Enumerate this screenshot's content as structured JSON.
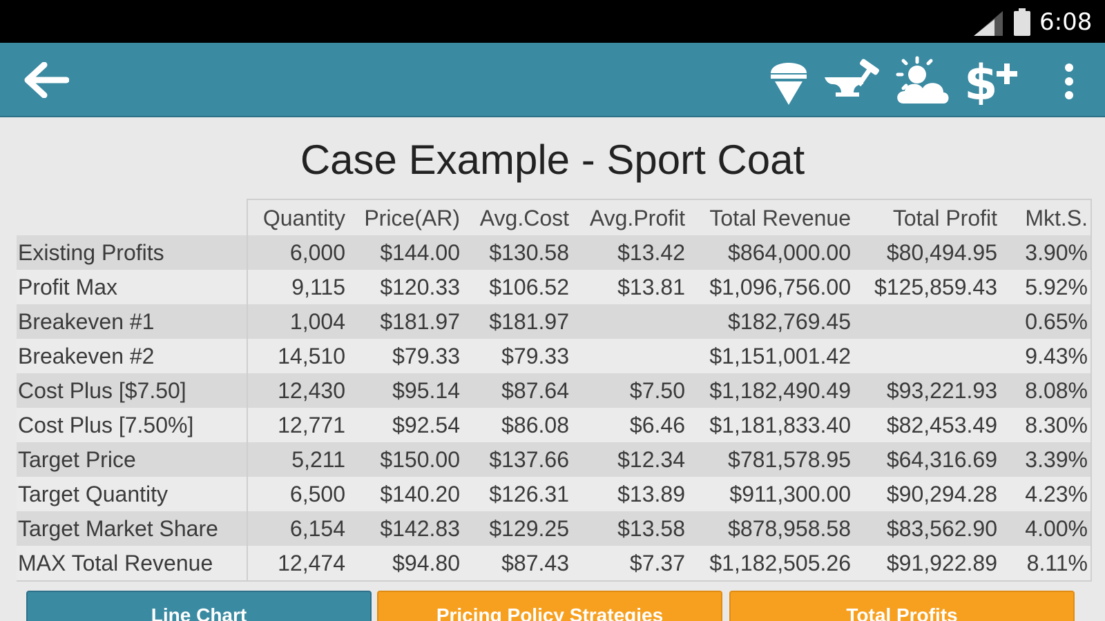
{
  "status_bar": {
    "time": "6:08",
    "icons": [
      "signal-icon",
      "battery-icon"
    ]
  },
  "action_bar": {
    "icons": [
      "back-arrow-icon",
      "ice-cream-icon",
      "anvil-hammer-icon",
      "sun-cloud-icon",
      "dollar-plus-icon",
      "overflow-menu-icon"
    ],
    "background_color": "#3a8aa2"
  },
  "title": "Case Example - Sport Coat",
  "table": {
    "columns": [
      "Quantity",
      "Price(AR)",
      "Avg.Cost",
      "Avg.Profit",
      "Total Revenue",
      "Total Profit",
      "Mkt.S."
    ],
    "rows": [
      {
        "label": "Existing Profits",
        "cells": [
          "6,000",
          "$144.00",
          "$130.58",
          "$13.42",
          "$864,000.00",
          "$80,494.95",
          "3.90%"
        ]
      },
      {
        "label": "Profit Max",
        "cells": [
          "9,115",
          "$120.33",
          "$106.52",
          "$13.81",
          "$1,096,756.00",
          "$125,859.43",
          "5.92%"
        ]
      },
      {
        "label": "Breakeven #1",
        "cells": [
          "1,004",
          "$181.97",
          "$181.97",
          "",
          "$182,769.45",
          "",
          "0.65%"
        ]
      },
      {
        "label": "Breakeven #2",
        "cells": [
          "14,510",
          "$79.33",
          "$79.33",
          "",
          "$1,151,001.42",
          "",
          "9.43%"
        ]
      },
      {
        "label": "Cost Plus [$7.50]",
        "cells": [
          "12,430",
          "$95.14",
          "$87.64",
          "$7.50",
          "$1,182,490.49",
          "$93,221.93",
          "8.08%"
        ]
      },
      {
        "label": "Cost Plus [7.50%]",
        "cells": [
          "12,771",
          "$92.54",
          "$86.08",
          "$6.46",
          "$1,181,833.40",
          "$82,453.49",
          "8.30%"
        ]
      },
      {
        "label": "Target Price",
        "cells": [
          "5,211",
          "$150.00",
          "$137.66",
          "$12.34",
          "$781,578.95",
          "$64,316.69",
          "3.39%"
        ]
      },
      {
        "label": "Target Quantity",
        "cells": [
          "6,500",
          "$140.20",
          "$126.31",
          "$13.89",
          "$911,300.00",
          "$90,294.28",
          "4.23%"
        ]
      },
      {
        "label": "Target Market Share",
        "cells": [
          "6,154",
          "$142.83",
          "$129.25",
          "$13.58",
          "$878,958.58",
          "$83,562.90",
          "4.00%"
        ]
      },
      {
        "label": "MAX Total Revenue",
        "cells": [
          "12,474",
          "$94.80",
          "$87.43",
          "$7.37",
          "$1,182,505.26",
          "$91,922.89",
          "8.11%"
        ]
      }
    ]
  },
  "buttons": {
    "line_chart": "Line Chart",
    "pricing_policy": "Pricing Policy Strategies",
    "total_profits": "Total Profits"
  },
  "colors": {
    "primary": "#3a8aa2",
    "accent": "#f7a020"
  }
}
